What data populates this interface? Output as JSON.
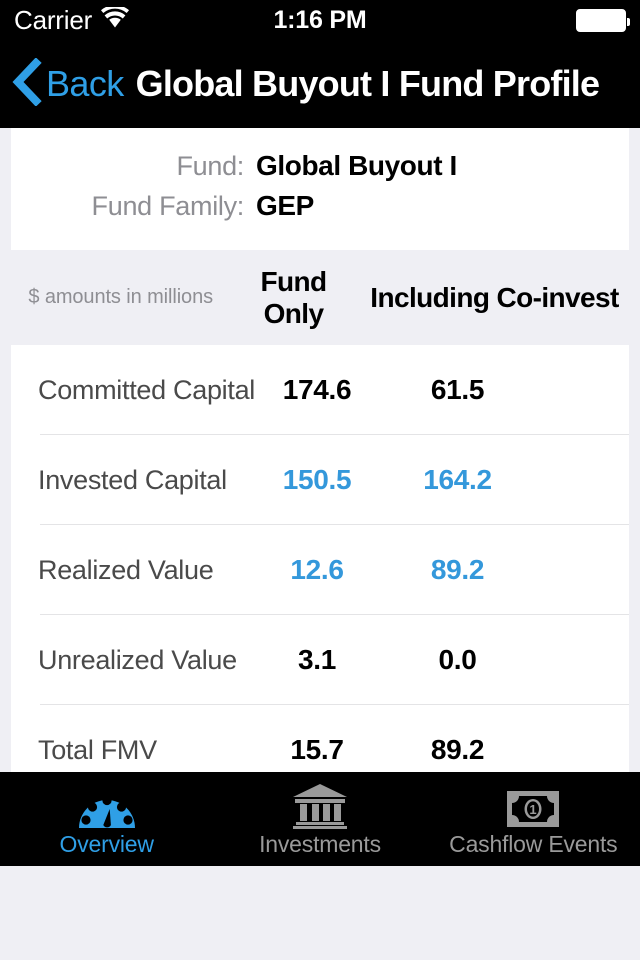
{
  "status_bar": {
    "carrier": "Carrier",
    "wifi_icon": "wifi-icon",
    "time": "1:16 PM",
    "battery_icon": "battery-full-icon"
  },
  "nav_bar": {
    "back_icon": "chevron-left-icon",
    "back_label": "Back",
    "title": "Global Buyout I Fund Profile"
  },
  "fund_info": {
    "rows": [
      {
        "label": "Fund:",
        "value": "Global Buyout I"
      },
      {
        "label": "Fund Family:",
        "value": "GEP"
      }
    ]
  },
  "table": {
    "note": "$ amounts in millions",
    "column_headers": [
      "Fund Only",
      "Including Co-invest"
    ],
    "rows": [
      {
        "label": "Committed Capital",
        "fund_only": "174.6",
        "fund_only_color": "black",
        "co_invest": "61.5",
        "co_invest_color": "black"
      },
      {
        "label": "Invested Capital",
        "fund_only": "150.5",
        "fund_only_color": "blue",
        "co_invest": "164.2",
        "co_invest_color": "blue"
      },
      {
        "label": "Realized Value",
        "fund_only": "12.6",
        "fund_only_color": "blue",
        "co_invest": "89.2",
        "co_invest_color": "blue"
      },
      {
        "label": "Unrealized Value",
        "fund_only": "3.1",
        "fund_only_color": "black",
        "co_invest": "0.0",
        "co_invest_color": "black"
      },
      {
        "label": "Total FMV",
        "fund_only": "15.7",
        "fund_only_color": "black",
        "co_invest": "89.2",
        "co_invest_color": "black"
      }
    ]
  },
  "tab_bar": {
    "items": [
      {
        "label": "Overview",
        "icon": "gauge-icon",
        "active": true
      },
      {
        "label": "Investments",
        "icon": "bank-icon",
        "active": false
      },
      {
        "label": "Cashflow Events",
        "icon": "banknote-icon",
        "active": false
      }
    ]
  },
  "colors": {
    "accent_blue": "#2f9fe6",
    "value_blue": "#3498db",
    "background": "#efeff4",
    "card": "#ffffff",
    "bar_black": "#000000",
    "muted_gray": "#8e8e93"
  }
}
